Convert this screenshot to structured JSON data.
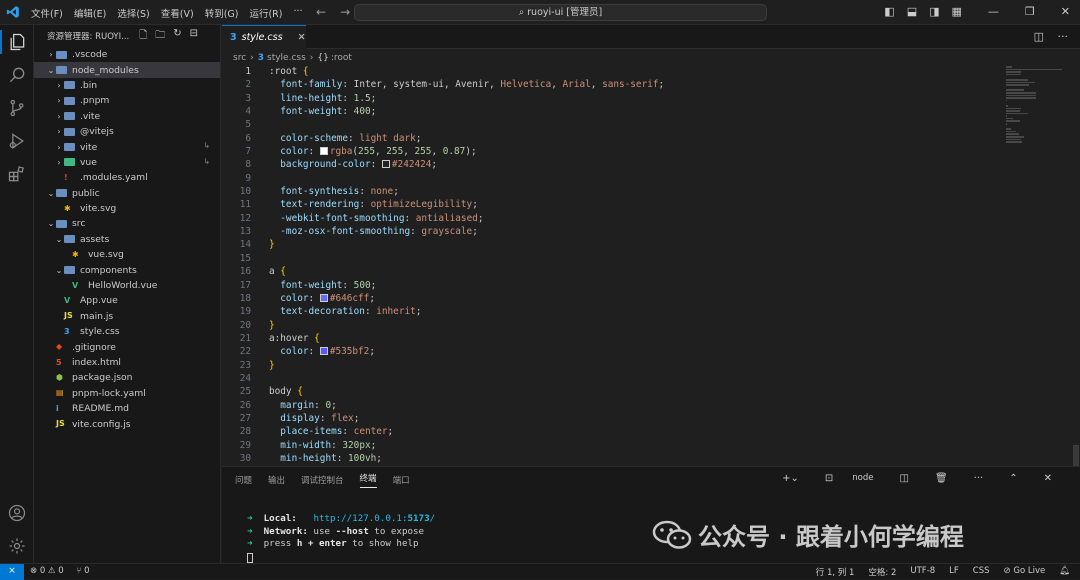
{
  "titlebar": {
    "menu": [
      "文件(F)",
      "编辑(E)",
      "选择(S)",
      "查看(V)",
      "转到(G)",
      "运行(R)",
      "···"
    ],
    "search": "ruoyi-ui [管理员]"
  },
  "explorer": {
    "title": "资源管理器: RUOYI...",
    "items": [
      {
        "label": ".vscode",
        "indent": 0,
        "type": "folder",
        "chev": "›"
      },
      {
        "label": "node_modules",
        "indent": 0,
        "type": "folder",
        "chev": "⌄"
      },
      {
        "label": ".bin",
        "indent": 1,
        "type": "folder",
        "chev": "›"
      },
      {
        "label": ".pnpm",
        "indent": 1,
        "type": "folder",
        "chev": "›"
      },
      {
        "label": ".vite",
        "indent": 1,
        "type": "folder",
        "chev": "›"
      },
      {
        "label": "@vitejs",
        "indent": 1,
        "type": "folder",
        "chev": "›"
      },
      {
        "label": "vite",
        "indent": 1,
        "type": "folder",
        "chev": "›"
      },
      {
        "label": "vue",
        "indent": 1,
        "type": "vue-folder",
        "chev": "›"
      },
      {
        "label": ".modules.yaml",
        "indent": 1,
        "type": "yaml",
        "chev": ""
      },
      {
        "label": "public",
        "indent": 0,
        "type": "folder",
        "chev": "⌄"
      },
      {
        "label": "vite.svg",
        "indent": 1,
        "type": "svg",
        "chev": ""
      },
      {
        "label": "src",
        "indent": 0,
        "type": "folder",
        "chev": "⌄"
      },
      {
        "label": "assets",
        "indent": 1,
        "type": "folder",
        "chev": "⌄"
      },
      {
        "label": "vue.svg",
        "indent": 2,
        "type": "svg",
        "chev": ""
      },
      {
        "label": "components",
        "indent": 1,
        "type": "folder",
        "chev": "⌄"
      },
      {
        "label": "HelloWorld.vue",
        "indent": 2,
        "type": "vue",
        "chev": ""
      },
      {
        "label": "App.vue",
        "indent": 1,
        "type": "vue",
        "chev": ""
      },
      {
        "label": "main.js",
        "indent": 1,
        "type": "js",
        "chev": ""
      },
      {
        "label": "style.css",
        "indent": 1,
        "type": "css",
        "chev": ""
      },
      {
        "label": ".gitignore",
        "indent": 0,
        "type": "git",
        "chev": ""
      },
      {
        "label": "index.html",
        "indent": 0,
        "type": "html",
        "chev": ""
      },
      {
        "label": "package.json",
        "indent": 0,
        "type": "json",
        "chev": ""
      },
      {
        "label": "pnpm-lock.yaml",
        "indent": 0,
        "type": "lock",
        "chev": ""
      },
      {
        "label": "README.md",
        "indent": 0,
        "type": "md",
        "chev": ""
      },
      {
        "label": "vite.config.js",
        "indent": 0,
        "type": "js",
        "chev": ""
      }
    ]
  },
  "editor": {
    "tab": "style.css",
    "breadcrumb": [
      "src",
      "style.css",
      ":root"
    ],
    "lines": [
      [
        [
          "sel",
          ":root "
        ],
        [
          "br",
          "{"
        ]
      ],
      [
        [
          "prop",
          "  font-family"
        ],
        [
          "punc",
          ": "
        ],
        [
          "punc",
          "Inter, system-ui, Avenir, "
        ],
        [
          "val",
          "Helvetica"
        ],
        [
          "punc",
          ", "
        ],
        [
          "val",
          "Arial"
        ],
        [
          "punc",
          ", "
        ],
        [
          "val",
          "sans-serif"
        ],
        [
          "punc",
          ";"
        ]
      ],
      [
        [
          "prop",
          "  line-height"
        ],
        [
          "punc",
          ": "
        ],
        [
          "num",
          "1.5"
        ],
        [
          "punc",
          ";"
        ]
      ],
      [
        [
          "prop",
          "  font-weight"
        ],
        [
          "punc",
          ": "
        ],
        [
          "num",
          "400"
        ],
        [
          "punc",
          ";"
        ]
      ],
      [],
      [
        [
          "prop",
          "  color-scheme"
        ],
        [
          "punc",
          ": "
        ],
        [
          "val",
          "light dark"
        ],
        [
          "punc",
          ";"
        ]
      ],
      [
        [
          "prop",
          "  color"
        ],
        [
          "punc",
          ": "
        ],
        [
          "sw:#ffffff",
          ""
        ],
        [
          "val",
          "rgba"
        ],
        [
          "punc",
          "("
        ],
        [
          "num",
          "255"
        ],
        [
          "punc",
          ", "
        ],
        [
          "num",
          "255"
        ],
        [
          "punc",
          ", "
        ],
        [
          "num",
          "255"
        ],
        [
          "punc",
          ", "
        ],
        [
          "num",
          "0.87"
        ],
        [
          "punc",
          ");"
        ]
      ],
      [
        [
          "prop",
          "  background-color"
        ],
        [
          "punc",
          ": "
        ],
        [
          "sw:#242424",
          ""
        ],
        [
          "val",
          "#242424"
        ],
        [
          "punc",
          ";"
        ]
      ],
      [],
      [
        [
          "prop",
          "  font-synthesis"
        ],
        [
          "punc",
          ": "
        ],
        [
          "val",
          "none"
        ],
        [
          "punc",
          ";"
        ]
      ],
      [
        [
          "prop",
          "  text-rendering"
        ],
        [
          "punc",
          ": "
        ],
        [
          "val",
          "optimizeLegibility"
        ],
        [
          "punc",
          ";"
        ]
      ],
      [
        [
          "prop",
          "  -webkit-font-smoothing"
        ],
        [
          "punc",
          ": "
        ],
        [
          "val",
          "antialiased"
        ],
        [
          "punc",
          ";"
        ]
      ],
      [
        [
          "prop",
          "  -moz-osx-font-smoothing"
        ],
        [
          "punc",
          ": "
        ],
        [
          "val",
          "grayscale"
        ],
        [
          "punc",
          ";"
        ]
      ],
      [
        [
          "br",
          "}"
        ]
      ],
      [],
      [
        [
          "sel",
          "a "
        ],
        [
          "br",
          "{"
        ]
      ],
      [
        [
          "prop",
          "  font-weight"
        ],
        [
          "punc",
          ": "
        ],
        [
          "num",
          "500"
        ],
        [
          "punc",
          ";"
        ]
      ],
      [
        [
          "prop",
          "  color"
        ],
        [
          "punc",
          ": "
        ],
        [
          "sw:#646cff",
          ""
        ],
        [
          "val",
          "#646cff"
        ],
        [
          "punc",
          ";"
        ]
      ],
      [
        [
          "prop",
          "  text-decoration"
        ],
        [
          "punc",
          ": "
        ],
        [
          "val",
          "inherit"
        ],
        [
          "punc",
          ";"
        ]
      ],
      [
        [
          "br",
          "}"
        ]
      ],
      [
        [
          "sel",
          "a:hover "
        ],
        [
          "br",
          "{"
        ]
      ],
      [
        [
          "prop",
          "  color"
        ],
        [
          "punc",
          ": "
        ],
        [
          "sw:#535bf2",
          ""
        ],
        [
          "val",
          "#535bf2"
        ],
        [
          "punc",
          ";"
        ]
      ],
      [
        [
          "br",
          "}"
        ]
      ],
      [],
      [
        [
          "sel",
          "body "
        ],
        [
          "br",
          "{"
        ]
      ],
      [
        [
          "prop",
          "  margin"
        ],
        [
          "punc",
          ": "
        ],
        [
          "num",
          "0"
        ],
        [
          "punc",
          ";"
        ]
      ],
      [
        [
          "prop",
          "  display"
        ],
        [
          "punc",
          ": "
        ],
        [
          "val",
          "flex"
        ],
        [
          "punc",
          ";"
        ]
      ],
      [
        [
          "prop",
          "  place-items"
        ],
        [
          "punc",
          ": "
        ],
        [
          "val",
          "center"
        ],
        [
          "punc",
          ";"
        ]
      ],
      [
        [
          "prop",
          "  min-width"
        ],
        [
          "punc",
          ": "
        ],
        [
          "num",
          "320px"
        ],
        [
          "punc",
          ";"
        ]
      ],
      [
        [
          "prop",
          "  min-height"
        ],
        [
          "punc",
          ": "
        ],
        [
          "num",
          "100vh"
        ],
        [
          "punc",
          ";"
        ]
      ]
    ],
    "line_numbers": [
      "1",
      "2",
      "3",
      "4",
      "5",
      "6",
      "7",
      "8",
      "9",
      "10",
      "11",
      "12",
      "13",
      "14",
      "15",
      "16",
      "17",
      "18",
      "19",
      "20",
      "21",
      "22",
      "23",
      "24",
      "25",
      "26",
      "27",
      "28",
      "29",
      "30"
    ]
  },
  "panel": {
    "tabs": [
      "问题",
      "输出",
      "调试控制台",
      "终端",
      "端口"
    ],
    "active_tab": "终端",
    "terminal_label": "node",
    "local_label": "Local:",
    "local_url": "http://127.0.0.1:",
    "local_port": "5173",
    "local_slash": "/",
    "network_label": "Network:",
    "network_text": " use ",
    "network_flag": "--host",
    "network_tail": " to expose",
    "help_pre": "press ",
    "help_key": "h + enter",
    "help_tail": " to show help"
  },
  "statusbar": {
    "remote": "⨯",
    "errors": "⊗ 0 ⚠ 0",
    "ports": "⑂ 0",
    "position": "行 1, 列 1",
    "spaces": "空格: 2",
    "encoding": "UTF-8",
    "eol": "LF",
    "language": "CSS",
    "golive": "⊘ Go Live"
  },
  "watermark": "公众号 · 跟着小何学编程",
  "colors": {
    "accent": "#0078d4",
    "editor_bg": "#1f1f1f",
    "sidebar_bg": "#181818"
  }
}
